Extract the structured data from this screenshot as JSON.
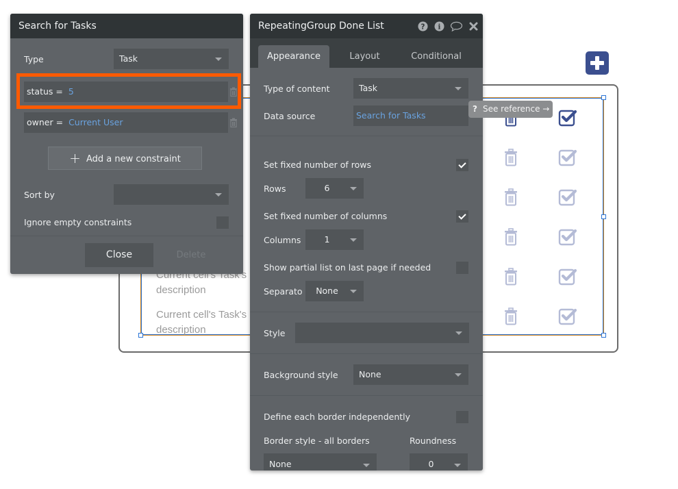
{
  "canvas": {
    "cell_text": [
      "Current cell's Task's description",
      "Current cell's Task's description"
    ],
    "rows": 6,
    "icon_colors": {
      "active": "#3b4f8f",
      "faded": "#b4bbd6"
    }
  },
  "search_panel": {
    "title": "Search for Tasks",
    "type_label": "Type",
    "type_value": "Task",
    "constraints": [
      {
        "field": "status =",
        "value": "5",
        "highlighted": true
      },
      {
        "field": "owner =",
        "value": "Current User",
        "highlighted": false
      }
    ],
    "add_constraint_label": "Add a new constraint",
    "sort_by_label": "Sort by",
    "sort_by_value": "",
    "ignore_empty_label": "Ignore empty constraints",
    "ignore_empty_checked": false,
    "close_label": "Close",
    "delete_label": "Delete",
    "highlight_color": "#ff5a00"
  },
  "property_panel": {
    "title": "RepeatingGroup Done List",
    "header_icons": [
      "help-icon",
      "info-icon",
      "comment-icon",
      "close-icon"
    ],
    "tabs": [
      {
        "label": "Appearance",
        "active": true
      },
      {
        "label": "Layout",
        "active": false
      },
      {
        "label": "Conditional",
        "active": false
      }
    ],
    "type_of_content_label": "Type of content",
    "type_of_content_value": "Task",
    "data_source_label": "Data source",
    "data_source_value": "Search for Tasks",
    "fixed_rows_label": "Set fixed number of rows",
    "fixed_rows_checked": true,
    "rows_label": "Rows",
    "rows_value": "6",
    "fixed_columns_label": "Set fixed number of columns",
    "fixed_columns_checked": true,
    "columns_label": "Columns",
    "columns_value": "1",
    "partial_list_label": "Show partial list on last page if needed",
    "partial_list_checked": false,
    "separator_label": "Separato",
    "separator_value": "None",
    "style_label": "Style",
    "style_value": "",
    "background_style_label": "Background style",
    "background_style_value": "None",
    "define_border_label": "Define each border independently",
    "define_border_checked": false,
    "border_style_label": "Border style - all borders",
    "border_style_value": "None",
    "roundness_label": "Roundness",
    "roundness_value": "0"
  },
  "tooltip": {
    "icon": "?",
    "text": "See reference →"
  }
}
